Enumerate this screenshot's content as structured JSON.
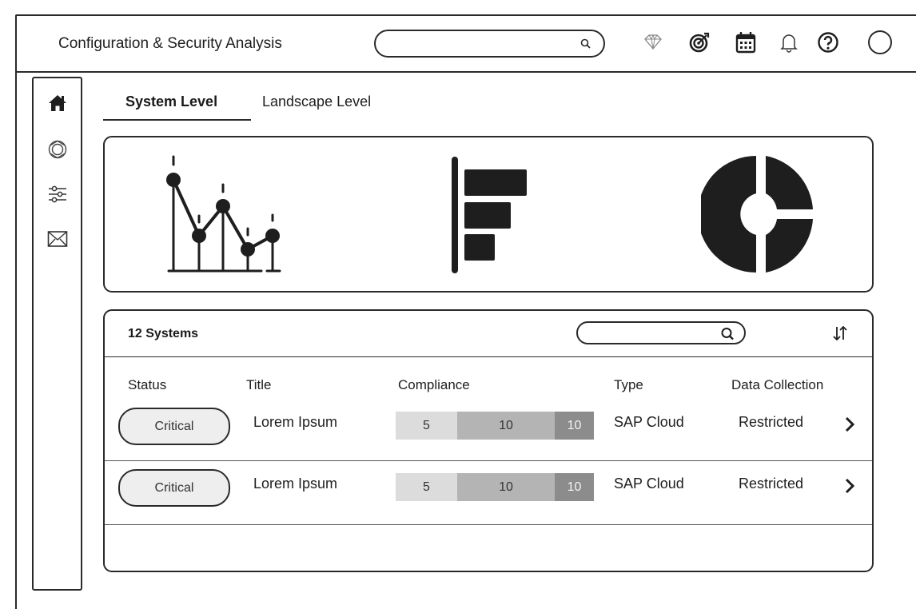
{
  "app": {
    "title": "Configuration & Security Analysis"
  },
  "header": {
    "search": {
      "value": "",
      "icon": "search-icon"
    },
    "icons": [
      "diamond-icon",
      "target-icon",
      "calendar-icon",
      "bell-icon",
      "help-icon",
      "avatar"
    ]
  },
  "sidebar": {
    "items": [
      "home-icon",
      "cycle-icon",
      "sliders-icon",
      "mail-icon"
    ]
  },
  "tabs": {
    "system": "System Level",
    "landscape": "Landscape Level",
    "active": "System Level"
  },
  "charts_panel": {
    "thumbnails": [
      "line-chart-icon",
      "bar-chart-icon",
      "donut-chart-icon"
    ]
  },
  "systems": {
    "count_label": "12 Systems",
    "search": {
      "value": ""
    },
    "columns": [
      "Status",
      "Title",
      "Compliance",
      "Type",
      "Data Collection"
    ],
    "rows": [
      {
        "status": "Critical",
        "title": "Lorem Ipsum",
        "compliance": [
          "5",
          "10",
          "10"
        ],
        "type": "SAP Cloud",
        "data_collection": "Restricted"
      },
      {
        "status": "Critical",
        "title": "Lorem Ipsum",
        "compliance": [
          "5",
          "10",
          "10"
        ],
        "type": "SAP Cloud",
        "data_collection": "Restricted"
      }
    ]
  },
  "colors": {
    "stroke": "#2a2a2a",
    "badge_bg": "#eeeeee",
    "comp_light": "#dcdcdc",
    "comp_mid": "#b4b4b4",
    "comp_dark": "#8c8c8c"
  }
}
